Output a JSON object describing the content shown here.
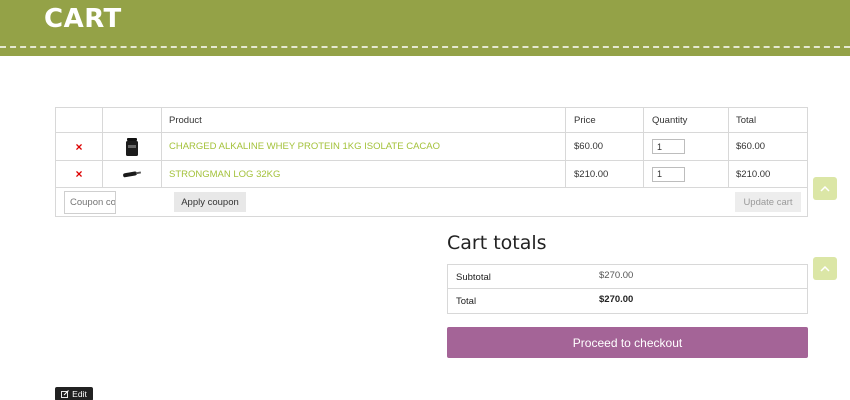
{
  "page": {
    "title": "CART"
  },
  "cart": {
    "columns": {
      "remove": "",
      "thumbnail": "",
      "product": "Product",
      "price": "Price",
      "quantity": "Quantity",
      "total": "Total"
    },
    "items": [
      {
        "remove_icon": "×",
        "thumbnail_icon": "protein-tub-icon",
        "name": "CHARGED ALKALINE WHEY PROTEIN 1KG ISOLATE CACAO",
        "price": "$60.00",
        "quantity": "1",
        "total": "$60.00"
      },
      {
        "remove_icon": "×",
        "thumbnail_icon": "log-bar-icon",
        "name": "STRONGMAN LOG 32KG",
        "price": "$210.00",
        "quantity": "1",
        "total": "$210.00"
      }
    ],
    "coupon": {
      "placeholder": "Coupon code",
      "apply_label": "Apply coupon"
    },
    "update_label": "Update cart"
  },
  "totals": {
    "title": "Cart totals",
    "subtotal_label": "Subtotal",
    "subtotal_value": "$270.00",
    "total_label": "Total",
    "total_value": "$270.00",
    "checkout_label": "Proceed to checkout"
  },
  "edit": {
    "label": "Edit",
    "icon": "edit-icon"
  },
  "colors": {
    "header_bg": "#94a247",
    "link": "#a4c23b",
    "checkout_bg": "#a46497",
    "remove": "#dd0000",
    "scroll_btn": "#dbe6a6"
  }
}
